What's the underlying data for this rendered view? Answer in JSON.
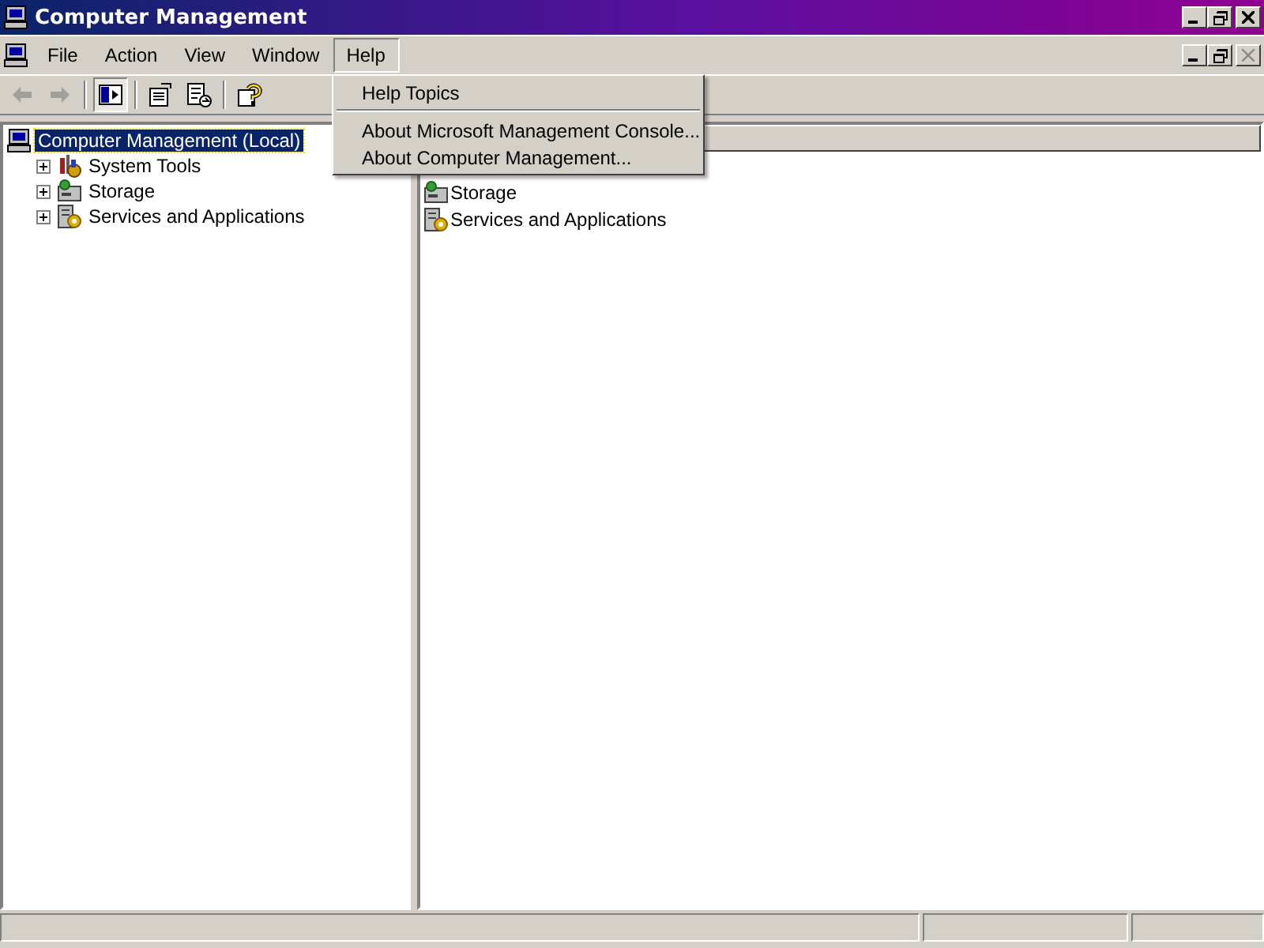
{
  "window": {
    "title": "Computer Management"
  },
  "menu_bar": [
    {
      "label": "File",
      "open": false
    },
    {
      "label": "Action",
      "open": false
    },
    {
      "label": "View",
      "open": false
    },
    {
      "label": "Window",
      "open": false
    },
    {
      "label": "Help",
      "open": true
    }
  ],
  "help_menu": [
    {
      "kind": "item",
      "label": "Help Topics"
    },
    {
      "kind": "separator"
    },
    {
      "kind": "item",
      "label": "About Microsoft Management Console..."
    },
    {
      "kind": "item",
      "label": "About Computer Management..."
    }
  ],
  "toolbar": [
    {
      "kind": "back",
      "disabled": true
    },
    {
      "kind": "forward",
      "disabled": true
    },
    {
      "kind": "sep"
    },
    {
      "kind": "tree",
      "pressed": true
    },
    {
      "kind": "sep"
    },
    {
      "kind": "properties",
      "pressed": false
    },
    {
      "kind": "export",
      "pressed": false
    },
    {
      "kind": "sep"
    },
    {
      "kind": "help",
      "pressed": false
    }
  ],
  "tree": [
    {
      "label": "Computer Management (Local)",
      "kind": "computer",
      "selected": true,
      "children": [
        {
          "label": "System Tools",
          "kind": "tools",
          "selected": false,
          "expanded": false
        },
        {
          "label": "Storage",
          "kind": "storage",
          "selected": false,
          "expanded": false
        },
        {
          "label": "Services and Applications",
          "kind": "services",
          "selected": false,
          "expanded": false
        }
      ]
    }
  ],
  "list": [
    {
      "label": "Storage",
      "kind": "storage"
    },
    {
      "label": "Services and Applications",
      "kind": "services"
    }
  ]
}
